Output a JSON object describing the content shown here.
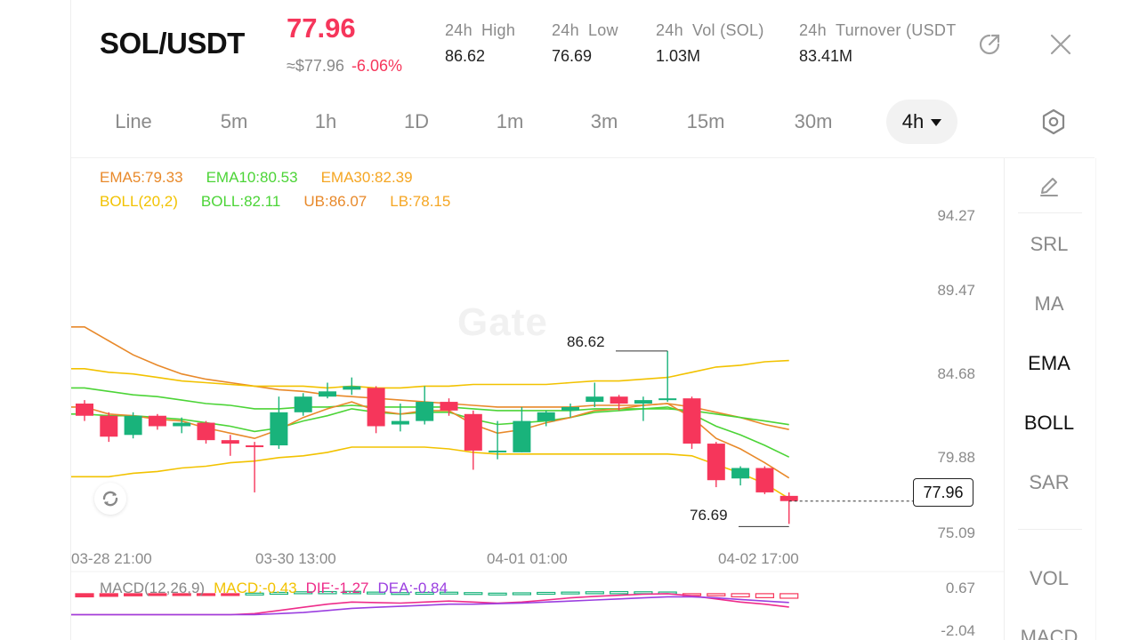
{
  "header": {
    "pair": "SOL/USDT",
    "price": "77.96",
    "approx_usd": "≈$77.96",
    "change": "-6.06%",
    "stats": [
      {
        "label_a": "24h",
        "label_b": "High",
        "value": "86.62"
      },
      {
        "label_a": "24h",
        "label_b": "Low",
        "value": "76.69"
      },
      {
        "label_a": "24h",
        "label_b": "Vol (SOL)",
        "value": "1.03M"
      },
      {
        "label_a": "24h",
        "label_b": "Turnover (USDT",
        "value": "83.41M"
      }
    ]
  },
  "tabs": [
    "Line",
    "5m",
    "1h",
    "1D",
    "1m",
    "3m",
    "15m",
    "30m",
    "4h"
  ],
  "active_tab": "4h",
  "legend": {
    "ema5": "EMA5:79.33",
    "ema10": "EMA10:80.53",
    "ema30": "EMA30:82.39",
    "boll_params": "BOLL(20,2)",
    "boll": "BOLL:82.11",
    "ub": "UB:86.07",
    "lb": "LB:78.15"
  },
  "macd_legend": {
    "params": "MACD(12,26,9)",
    "macd": "MACD:-0.43",
    "dif": "DIF:-1.27",
    "dea": "DEA:-0.84"
  },
  "tools": {
    "srl": "SRL",
    "ma": "MA",
    "ema": "EMA",
    "boll": "BOLL",
    "sar": "SAR",
    "vol": "VOL",
    "macd": "MACD"
  },
  "watermark": "Gate",
  "current_price_tag": "77.96",
  "macd_axis": [
    "0.67",
    "-2.04"
  ],
  "colors": {
    "up": "#19b37b",
    "down": "#f6365b",
    "ema5": "#e8892a",
    "ema10": "#4cd437",
    "ema30": "#f5a623",
    "boll": "#f2c200",
    "dif": "#ee2c8a",
    "dea": "#9b3fe0"
  },
  "chart_data": {
    "type": "candlestick",
    "interval": "4h",
    "y_ticks": [
      "94.27",
      "89.47",
      "84.68",
      "79.88",
      "75.09"
    ],
    "x_ticks": [
      "03-28 21:00",
      "03-30 13:00",
      "04-01 01:00",
      "04-02 17:00"
    ],
    "high_marker": "86.62",
    "low_marker": "76.69",
    "candles": [
      {
        "o": 83.6,
        "c": 82.9,
        "h": 83.8,
        "l": 82.6
      },
      {
        "o": 82.9,
        "c": 81.7,
        "h": 83.1,
        "l": 81.4
      },
      {
        "o": 81.8,
        "c": 82.9,
        "h": 83.1,
        "l": 81.6
      },
      {
        "o": 82.9,
        "c": 82.3,
        "h": 83.0,
        "l": 82.1
      },
      {
        "o": 82.3,
        "c": 82.5,
        "h": 82.8,
        "l": 81.9
      },
      {
        "o": 82.5,
        "c": 81.5,
        "h": 82.6,
        "l": 81.3
      },
      {
        "o": 81.5,
        "c": 81.3,
        "h": 81.8,
        "l": 80.6
      },
      {
        "o": 81.2,
        "c": 81.1,
        "h": 81.4,
        "l": 78.5
      },
      {
        "o": 81.2,
        "c": 83.1,
        "h": 84.0,
        "l": 81.0
      },
      {
        "o": 83.1,
        "c": 84.0,
        "h": 84.2,
        "l": 82.9
      },
      {
        "o": 84.0,
        "c": 84.3,
        "h": 84.8,
        "l": 83.9
      },
      {
        "o": 84.4,
        "c": 84.6,
        "h": 85.1,
        "l": 84.1
      },
      {
        "o": 84.5,
        "c": 82.3,
        "h": 84.6,
        "l": 81.9
      },
      {
        "o": 82.4,
        "c": 82.6,
        "h": 83.6,
        "l": 82.0
      },
      {
        "o": 82.6,
        "c": 83.7,
        "h": 84.6,
        "l": 82.4
      },
      {
        "o": 83.7,
        "c": 83.2,
        "h": 83.9,
        "l": 82.9
      },
      {
        "o": 83.0,
        "c": 80.9,
        "h": 83.2,
        "l": 79.8
      },
      {
        "o": 80.9,
        "c": 80.9,
        "h": 82.6,
        "l": 80.4
      },
      {
        "o": 80.8,
        "c": 82.6,
        "h": 83.4,
        "l": 80.8
      },
      {
        "o": 82.6,
        "c": 83.1,
        "h": 83.2,
        "l": 82.3
      },
      {
        "o": 83.2,
        "c": 83.4,
        "h": 83.6,
        "l": 82.8
      },
      {
        "o": 83.7,
        "c": 84.0,
        "h": 84.8,
        "l": 83.4
      },
      {
        "o": 84.0,
        "c": 83.6,
        "h": 84.1,
        "l": 83.2
      },
      {
        "o": 83.6,
        "c": 83.8,
        "h": 84.0,
        "l": 82.6
      },
      {
        "o": 83.8,
        "c": 83.9,
        "h": 86.62,
        "l": 83.7
      },
      {
        "o": 83.9,
        "c": 81.3,
        "h": 84.0,
        "l": 81.0
      },
      {
        "o": 81.3,
        "c": 79.2,
        "h": 81.4,
        "l": 78.8
      },
      {
        "o": 79.3,
        "c": 79.9,
        "h": 80.0,
        "l": 78.9
      },
      {
        "o": 79.9,
        "c": 78.5,
        "h": 80.0,
        "l": 78.4
      },
      {
        "o": 78.3,
        "c": 78.0,
        "h": 78.5,
        "l": 76.69
      }
    ],
    "ema5": [
      83.4,
      83.0,
      82.9,
      82.7,
      82.6,
      82.2,
      81.9,
      81.6,
      82.1,
      82.8,
      83.3,
      83.7,
      83.2,
      83.0,
      83.2,
      83.2,
      82.4,
      81.9,
      82.1,
      82.5,
      82.8,
      83.2,
      83.3,
      83.5,
      83.6,
      82.8,
      81.6,
      81.0,
      80.2,
      79.33
    ],
    "ema10": [
      83.0,
      82.9,
      82.9,
      82.8,
      82.7,
      82.5,
      82.3,
      82.0,
      82.2,
      82.6,
      82.9,
      83.3,
      83.1,
      83.0,
      83.1,
      83.1,
      82.7,
      82.4,
      82.5,
      82.6,
      82.8,
      83.1,
      83.2,
      83.3,
      83.4,
      83.0,
      82.3,
      81.8,
      81.2,
      80.53
    ],
    "ema30": [
      84.5,
      84.3,
      84.1,
      84.0,
      83.8,
      83.6,
      83.5,
      83.3,
      83.3,
      83.4,
      83.4,
      83.5,
      83.4,
      83.4,
      83.4,
      83.4,
      83.3,
      83.2,
      83.2,
      83.2,
      83.2,
      83.3,
      83.3,
      83.3,
      83.3,
      83.2,
      83.0,
      82.8,
      82.6,
      82.39
    ],
    "boll_mid": [
      88.0,
      87.2,
      86.4,
      85.8,
      85.3,
      85.0,
      84.8,
      84.6,
      84.4,
      84.3,
      84.1,
      84.0,
      83.9,
      83.8,
      83.7,
      83.6,
      83.5,
      83.4,
      83.4,
      83.4,
      83.4,
      83.5,
      83.5,
      83.5,
      83.6,
      83.4,
      83.1,
      82.8,
      82.4,
      82.11
    ],
    "boll_ub": [
      85.6,
      85.4,
      85.3,
      85.1,
      84.9,
      84.8,
      84.7,
      84.6,
      84.6,
      84.6,
      84.5,
      84.6,
      84.5,
      84.5,
      84.6,
      84.6,
      84.7,
      84.7,
      84.7,
      84.7,
      84.8,
      84.9,
      84.9,
      85.0,
      85.1,
      85.4,
      85.7,
      85.8,
      86.0,
      86.07
    ],
    "boll_lb": [
      79.4,
      79.4,
      79.6,
      79.7,
      79.9,
      80.0,
      80.2,
      80.3,
      80.5,
      80.6,
      80.8,
      81.1,
      81.1,
      81.1,
      81.1,
      81.0,
      80.8,
      80.7,
      80.7,
      80.7,
      80.7,
      80.7,
      80.7,
      80.7,
      80.7,
      80.6,
      80.1,
      79.6,
      79.0,
      78.15
    ],
    "macd_hist": [
      -0.3,
      -0.25,
      -0.2,
      -0.15,
      -0.12,
      -0.08,
      -0.02,
      0.05,
      0.12,
      0.18,
      0.2,
      0.22,
      0.15,
      0.1,
      0.12,
      0.14,
      0.1,
      0.05,
      0.08,
      0.12,
      0.15,
      0.18,
      0.2,
      0.18,
      0.16,
      -0.05,
      -0.2,
      -0.3,
      -0.38,
      -0.43
    ],
    "dif": [
      -2.0,
      -2.0,
      -2.0,
      -2.0,
      -2.0,
      -2.0,
      -2.0,
      -1.9,
      -1.6,
      -1.3,
      -1.0,
      -0.8,
      -0.85,
      -0.9,
      -0.8,
      -0.7,
      -0.8,
      -0.9,
      -0.8,
      -0.6,
      -0.4,
      -0.25,
      -0.15,
      -0.05,
      0.0,
      -0.2,
      -0.5,
      -0.8,
      -1.0,
      -1.27
    ],
    "dea": [
      -2.0,
      -2.0,
      -2.0,
      -2.0,
      -2.0,
      -2.0,
      -2.0,
      -2.0,
      -1.9,
      -1.8,
      -1.6,
      -1.4,
      -1.3,
      -1.2,
      -1.1,
      -1.0,
      -1.0,
      -0.95,
      -0.9,
      -0.8,
      -0.7,
      -0.6,
      -0.5,
      -0.4,
      -0.3,
      -0.3,
      -0.4,
      -0.55,
      -0.7,
      -0.84
    ]
  }
}
